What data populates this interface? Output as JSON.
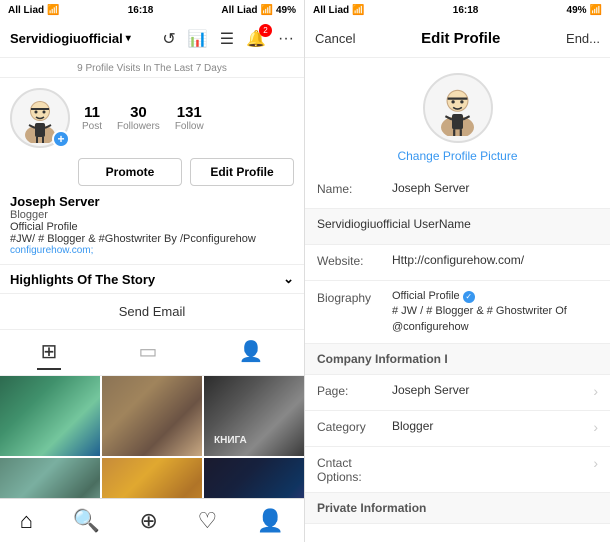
{
  "left": {
    "status": {
      "carrier": "All Liad",
      "time": "16:18",
      "battery": "49%"
    },
    "nav": {
      "brand": "Servidiogiuofficial",
      "icons": [
        "history",
        "chart",
        "list",
        "notifications",
        "more"
      ]
    },
    "visits_notice": "9 Profile Visits In The Last 7 Days",
    "profile": {
      "name": "Joseph Server",
      "role": "Blogger",
      "bio_line1": "Official Profile",
      "bio_line2": "#JW/ # Blogger & #Ghostwriter By /Pconfigurehow",
      "link": "configurehow.com;"
    },
    "stats": [
      {
        "num": "11",
        "label": "Post"
      },
      {
        "num": "30",
        "label": "Followers"
      },
      {
        "num": "131",
        "label": "Follow"
      }
    ],
    "buttons": {
      "promote": "Promote",
      "edit": "Edit Profile"
    },
    "highlights_label": "Highlights Of The Story",
    "send_email": "Send Email",
    "media_tabs": [
      "grid",
      "tablet",
      "person"
    ],
    "bottom_nav": [
      "home",
      "search",
      "add",
      "heart",
      "profile"
    ]
  },
  "right": {
    "status": {
      "carrier": "All Liad",
      "time": "16:18",
      "battery": "49%"
    },
    "nav": {
      "cancel": "Cancel",
      "title": "Edit Profile",
      "end": "End..."
    },
    "change_pic_label": "Change Profile Picture",
    "form": [
      {
        "type": "field",
        "label": "Name:",
        "value": "Joseph Server"
      },
      {
        "type": "section_label",
        "value": "Servidiogiuofficial UserName"
      },
      {
        "type": "field",
        "label": "Website:",
        "value": "Http://configurehow.com/"
      },
      {
        "type": "bio",
        "label": "Biography",
        "value": "Official Profile ✓\n# JW / # Blogger & # Ghostwriter Of\n@configurehow"
      },
      {
        "type": "section_label",
        "value": "Company Information I"
      },
      {
        "type": "field_arrow",
        "label": "Page:",
        "value": "Joseph Server"
      },
      {
        "type": "field_arrow",
        "label": "Category",
        "value": "Blogger"
      },
      {
        "type": "field_arrow",
        "label": "Cntact Options:",
        "value": ""
      },
      {
        "type": "section_label",
        "value": "Private Information"
      }
    ]
  }
}
